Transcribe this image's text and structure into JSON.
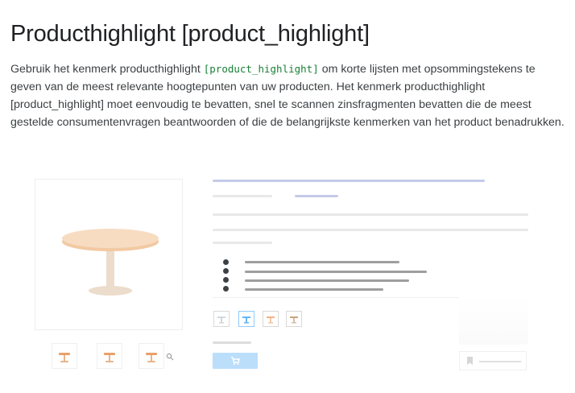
{
  "heading": {
    "title": "Producthighlight [product_highlight]"
  },
  "intro": {
    "part1": "Gebruik het kenmerk producthighlight ",
    "code": "[product_highlight]",
    "part2": " om korte lijsten met opsommingstekens te geven van de meest relevante hoogtepunten van uw producten. Het kenmerk producthighlight [product_highlight] moet eenvoudig te bevatten, snel te scannen zinsfragmenten bevatten die de meest gestelde consumentenvragen beantwoorden of die de belangrijkste kenmerken van het product benadrukken."
  },
  "illustration": {
    "main_image_icon": "round-table-icon",
    "thumbnail_icons": [
      "table-thumbnail-icon",
      "table-thumbnail-icon",
      "table-thumbnail-icon"
    ],
    "zoom_icon": "magnifier-icon",
    "highlight_bullets": 4,
    "variant_icons": [
      "table-variant-icon",
      "table-variant-icon",
      "table-variant-icon",
      "table-variant-icon"
    ],
    "cart_icon": "shopping-cart-icon",
    "bookmark_icon": "bookmark-icon",
    "colors": {
      "accent_blue": "#c5cae9",
      "cart_blue": "#bbdefb",
      "wood": "#f5d6b8",
      "leg": "#ead9c8"
    }
  }
}
